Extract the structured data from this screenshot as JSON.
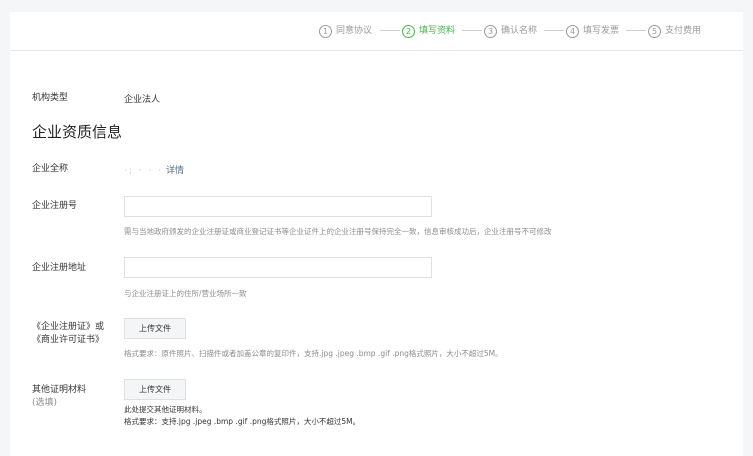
{
  "steps": [
    {
      "num": "1",
      "label": "同意协议"
    },
    {
      "num": "2",
      "label": "填写资料"
    },
    {
      "num": "3",
      "label": "确认名称"
    },
    {
      "num": "4",
      "label": "填写发票"
    },
    {
      "num": "5",
      "label": "支付费用"
    }
  ],
  "colors": {
    "active": "#44b549",
    "link": "#576b95"
  },
  "org_type": {
    "label": "机构类型",
    "value": "企业法人"
  },
  "section_title": "企业资质信息",
  "company_name": {
    "label": "企业全称",
    "value_masked": "·; · ·  ·",
    "detail_link": "详情"
  },
  "reg_number": {
    "label": "企业注册号",
    "value": "",
    "hint": "需与当地政府颁发的企业注册证或商业登记证书等企业证件上的企业注册号保持完全一致，信息审核成功后，企业注册号不可修改"
  },
  "reg_address": {
    "label": "企业注册地址",
    "value": "",
    "hint": "与企业注册证上的住所/营业场所一致"
  },
  "license": {
    "label_line1": "《企业注册证》或",
    "label_line2": "《商业许可证书》",
    "button": "上传文件",
    "hint": "格式要求：原件照片、扫描件或者加盖公章的复印件，支持.jpg .jpeg .bmp .gif .png格式照片，大小不超过5M。"
  },
  "other_docs": {
    "label": "其他证明材料",
    "optional": "(选填)",
    "button": "上传文件",
    "hint1": "此处提交其他证明材料。",
    "hint2": "格式要求：支持.jpg .jpeg .bmp .gif .png格式照片，大小不超过5M。"
  }
}
